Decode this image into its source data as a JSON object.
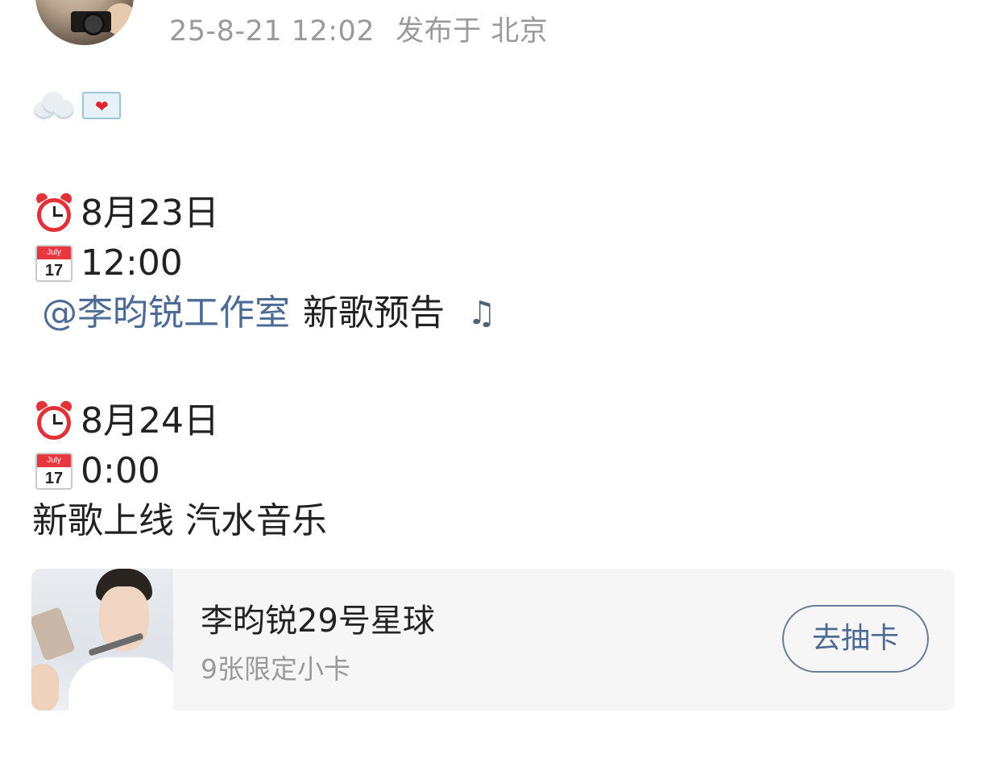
{
  "post": {
    "meta": {
      "timestamp": "25-8-21 12:02",
      "location": "发布于 北京"
    },
    "lead_emojis": [
      "cloud-emoji",
      "love-letter-emoji"
    ],
    "schedule": [
      {
        "date": "8月23日",
        "time": "12:00",
        "mention": "@李昀锐工作室",
        "text": "新歌预告",
        "trailing_icon": "♫"
      },
      {
        "date": "8月24日",
        "time": "0:00",
        "text": "新歌上线 汽水音乐"
      }
    ],
    "calendar_icon": {
      "month": "July",
      "day": "17"
    }
  },
  "card": {
    "title": "李昀锐29号星球",
    "subtitle": "9张限定小卡",
    "button_label": "去抽卡"
  }
}
